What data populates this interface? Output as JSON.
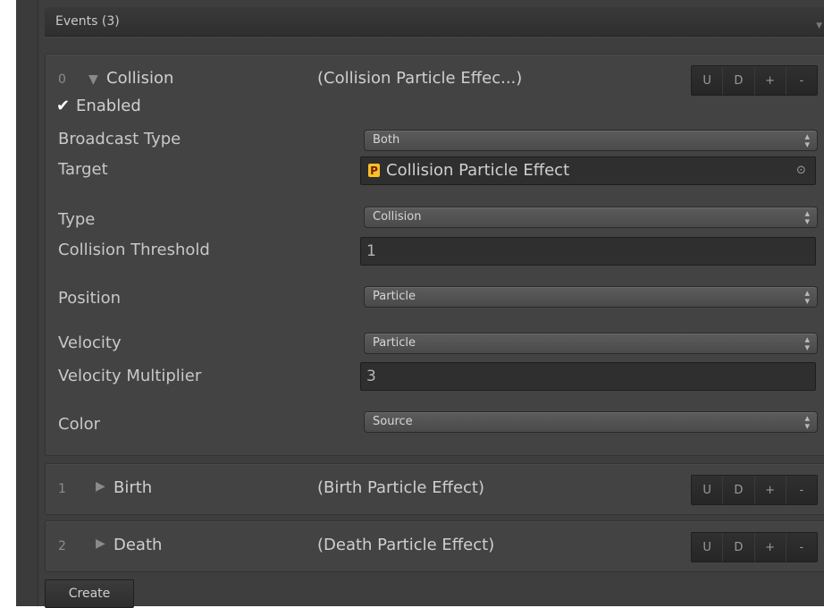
{
  "header": {
    "title": "Events (3)"
  },
  "buttons": {
    "up": "U",
    "down": "D",
    "add": "+",
    "remove": "-"
  },
  "events": [
    {
      "index": "0",
      "name": "Collision",
      "subtitle": "(Collision Particle Effec...)",
      "expanded": true,
      "enabled_label": "Enabled",
      "enabled": true,
      "fields": {
        "broadcast_type": {
          "label": "Broadcast Type",
          "value": "Both"
        },
        "target": {
          "label": "Target",
          "value": "Collision Particle Effect",
          "badge": "P"
        },
        "type": {
          "label": "Type",
          "value": "Collision"
        },
        "collision_threshold": {
          "label": "Collision Threshold",
          "value": "1"
        },
        "position": {
          "label": "Position",
          "value": "Particle"
        },
        "velocity": {
          "label": "Velocity",
          "value": "Particle"
        },
        "velocity_multiplier": {
          "label": "Velocity Multiplier",
          "value": "3"
        },
        "color": {
          "label": "Color",
          "value": "Source"
        }
      }
    },
    {
      "index": "1",
      "name": "Birth",
      "subtitle": "(Birth Particle Effect)",
      "expanded": false
    },
    {
      "index": "2",
      "name": "Death",
      "subtitle": "(Death Particle Effect)",
      "expanded": false
    }
  ],
  "footer": {
    "create_label": "Create"
  },
  "icons": {
    "expanded": "triangle-down-icon",
    "collapsed": "triangle-right-icon",
    "checkbox": "checkmark-icon",
    "object_picker": "target-picker-icon",
    "dropdown": "updown-chevron-icon"
  },
  "colors": {
    "panel": "#3e3e3e",
    "badge": "#f6c12a"
  }
}
